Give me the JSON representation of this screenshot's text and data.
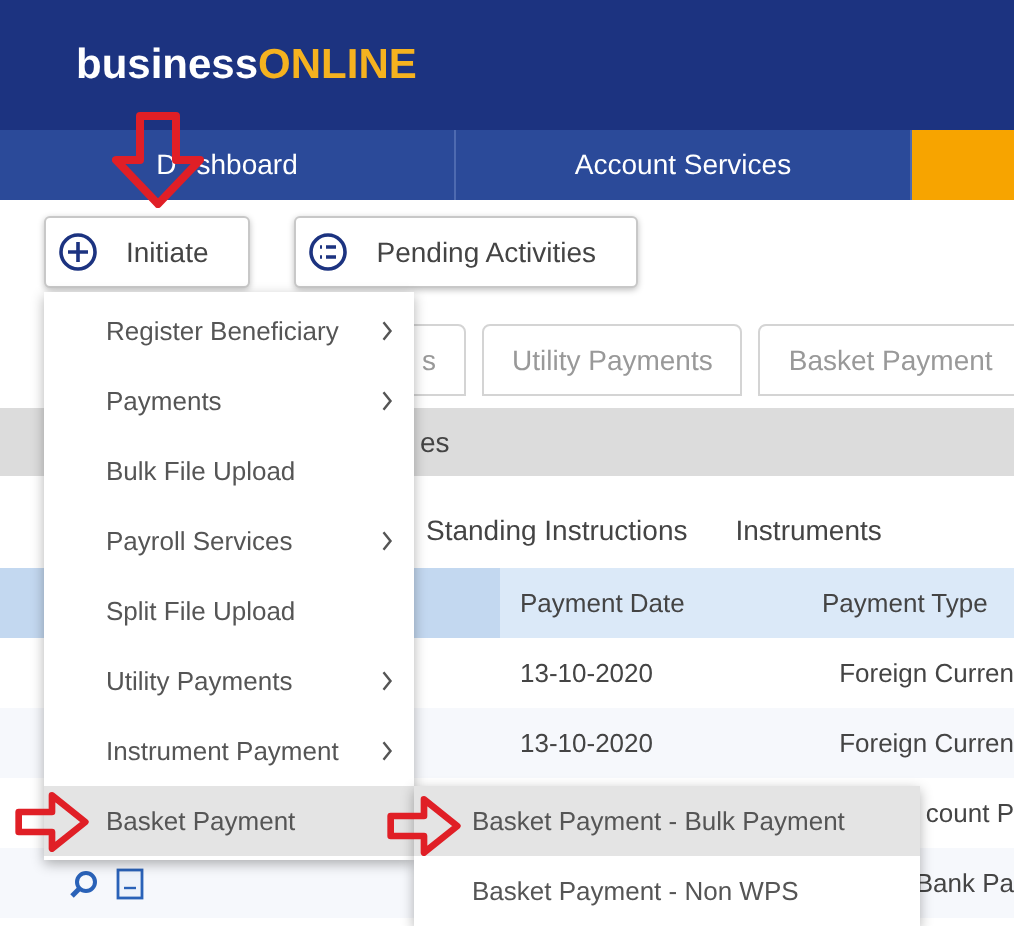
{
  "logo": {
    "parts": [
      {
        "text": "business",
        "accent": false
      },
      {
        "text": "ONLINE",
        "accent": true
      }
    ]
  },
  "nav": [
    {
      "label_parts": [
        "D",
        "shboard"
      ],
      "selected": false
    },
    {
      "label": "Account Services",
      "selected": false
    },
    {
      "selected": true
    }
  ],
  "actions": [
    {
      "label": "Initiate",
      "kind": "plus"
    },
    {
      "label": "Pending Activities",
      "kind": "list"
    }
  ],
  "tabs": [
    {
      "label": "s"
    },
    {
      "label": "Utility Payments"
    },
    {
      "label": "Basket Payment"
    }
  ],
  "section_title": "es",
  "sub_tabs": [
    "Standing Instructions",
    "Instruments"
  ],
  "table": {
    "columns": [
      "Payment Date",
      "Payment Type"
    ],
    "rows": [
      {
        "date": "13-10-2020",
        "type": "Foreign Curren"
      },
      {
        "date": "13-10-2020",
        "type": "Foreign Curren"
      },
      {
        "type": "count P"
      },
      {
        "type": "Bank Pa"
      }
    ]
  },
  "menu": [
    {
      "label": "Register Beneficiary",
      "submenu": true,
      "selected": false
    },
    {
      "label": "Payments",
      "submenu": true,
      "selected": false
    },
    {
      "label": "Bulk File Upload",
      "submenu": false,
      "selected": false
    },
    {
      "label": "Payroll Services",
      "submenu": true,
      "selected": false
    },
    {
      "label": "Split File Upload",
      "submenu": false,
      "selected": false
    },
    {
      "label": "Utility Payments",
      "submenu": true,
      "selected": false
    },
    {
      "label": "Instrument Payment",
      "submenu": true,
      "selected": false
    },
    {
      "label": "Basket Payment",
      "submenu": false,
      "selected": true
    }
  ],
  "submenu": [
    {
      "label": "Basket Payment - Bulk Payment",
      "selected": true
    },
    {
      "label": "Basket Payment - Non WPS",
      "selected": false
    }
  ]
}
